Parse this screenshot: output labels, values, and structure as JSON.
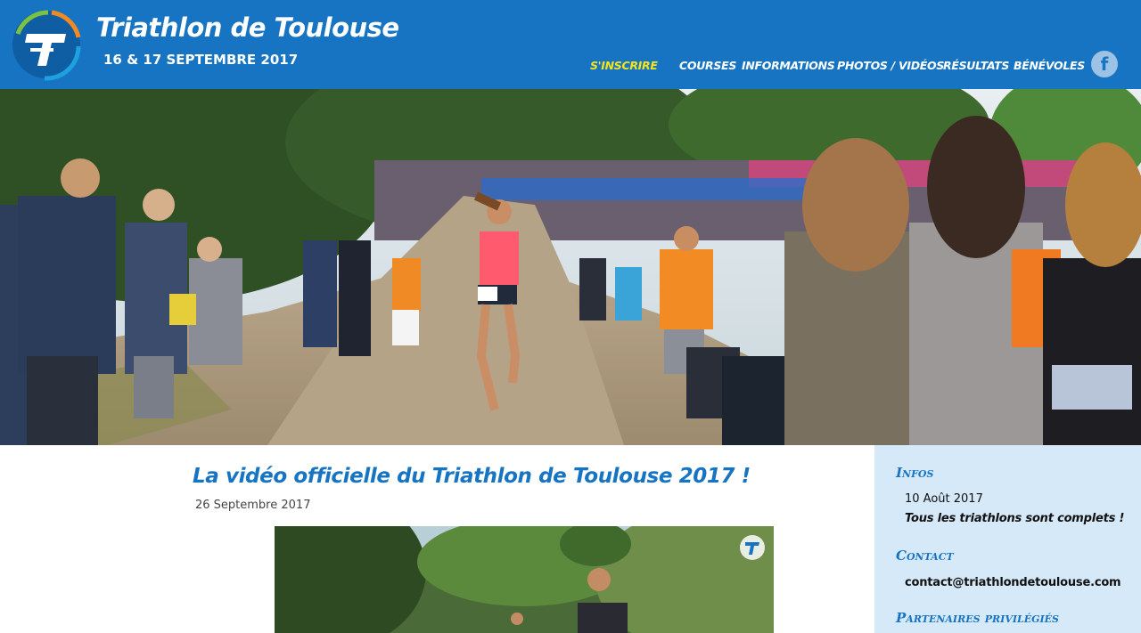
{
  "header": {
    "title": "Triathlon de Toulouse",
    "date": "16 & 17 SEPTEMBRE 2017",
    "brand_color": "#1674c3",
    "logo_icon": "triathlon-t-logo-icon"
  },
  "nav": {
    "items": [
      {
        "label": "S'INSCRIRE",
        "accent": true
      },
      {
        "label": "COURSES"
      },
      {
        "label": "INFORMATIONS"
      },
      {
        "label": "PHOTOS / VIDÉOS"
      },
      {
        "label": "RÉSULTATS"
      },
      {
        "label": "BÉNÉVOLES"
      }
    ],
    "accent_color": "#f5e41a",
    "social_icon": "facebook-icon",
    "social_glyph": "f"
  },
  "article": {
    "title": "La vidéo officielle du Triathlon de Toulouse 2017 !",
    "date": "26 Septembre 2017"
  },
  "sidebar": {
    "infos_heading": "Infos",
    "infos_date": "10 Août 2017",
    "infos_text": "Tous les triathlons sont complets !",
    "contact_heading": "Contact",
    "contact_email": "contact@triathlondetoulouse.com",
    "partners_heading": "Partenaires privilégiés",
    "background": "#d6e9f8"
  }
}
